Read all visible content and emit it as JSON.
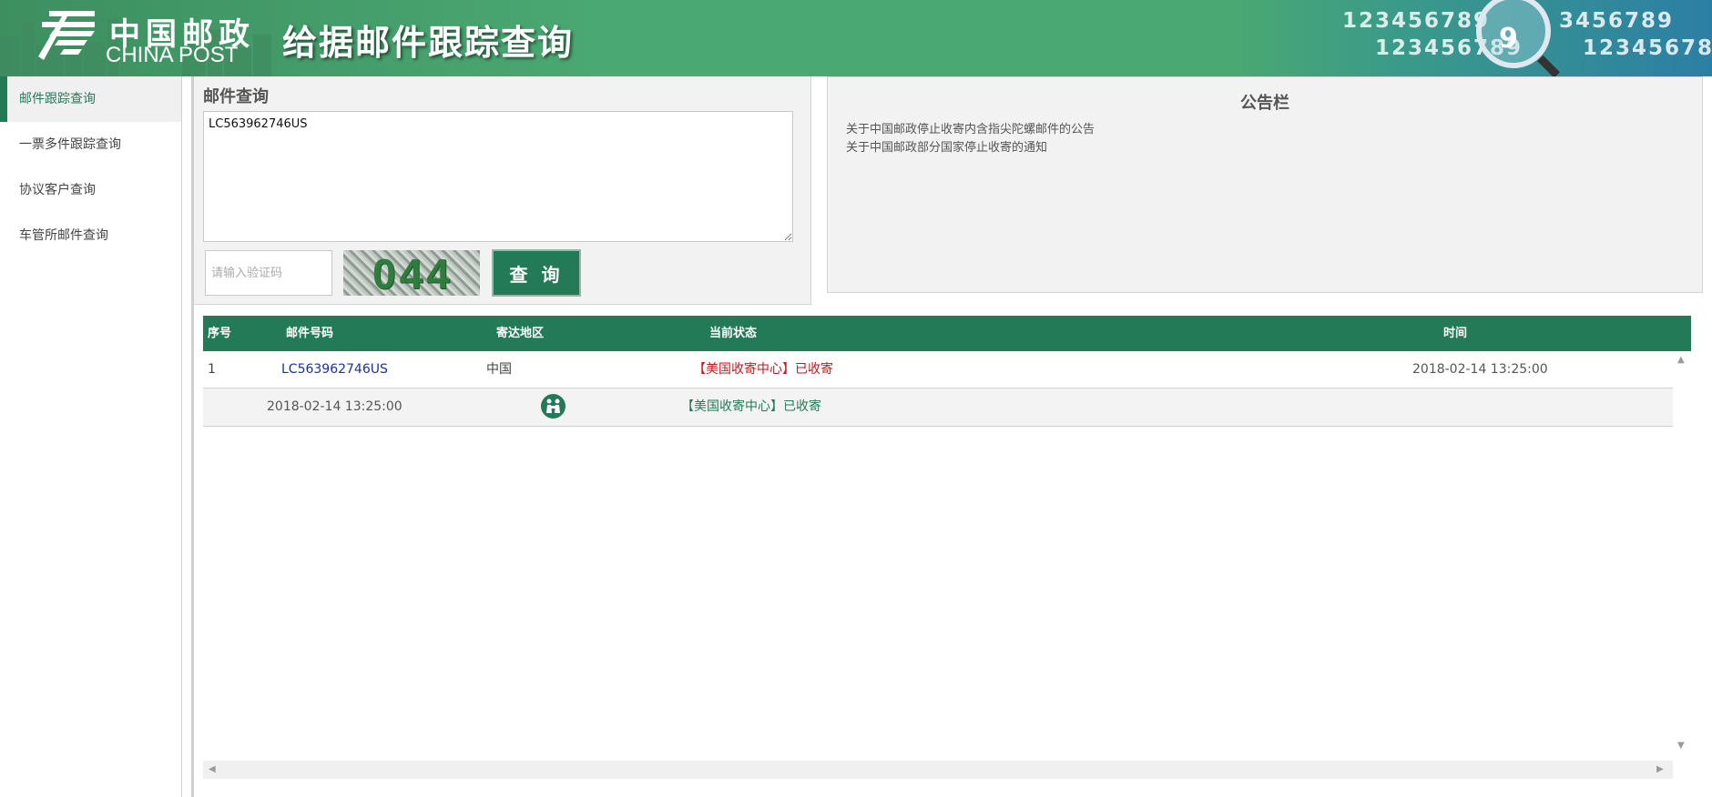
{
  "header": {
    "logo_cn": "中国邮政",
    "logo_en": "CHINA POST",
    "site_title": "给据邮件跟踪查询",
    "deco_numbers": [
      "123456789",
      "123456789",
      "3456789",
      "123456789"
    ]
  },
  "sidebar": {
    "items": [
      {
        "label": "邮件跟踪查询",
        "active": true
      },
      {
        "label": "一票多件跟踪查询",
        "active": false
      },
      {
        "label": "协议客户查询",
        "active": false
      },
      {
        "label": "车管所邮件查询",
        "active": false
      }
    ]
  },
  "query": {
    "title": "邮件查询",
    "tracking_value": "LC563962746US",
    "captcha_placeholder": "请输入验证码",
    "captcha_text": "044",
    "button_label": "查 询"
  },
  "notice": {
    "title": "公告栏",
    "items": [
      "关于中国邮政停止收寄内含指尖陀螺邮件的公告",
      "关于中国邮政部分国家停止收寄的通知"
    ]
  },
  "results": {
    "headers": [
      "序号",
      "邮件号码",
      "寄达地区",
      "当前状态",
      "时间"
    ],
    "rows": [
      {
        "index": "1",
        "tracking_no": "LC563962746US",
        "destination": "中国",
        "status": "【美国收寄中心】已收寄",
        "time": "2018-02-14 13:25:00"
      }
    ],
    "detail": {
      "time": "2018-02-14 13:25:00",
      "event": "【美国收寄中心】已收寄",
      "icon": "handover-icon"
    }
  },
  "colors": {
    "brand_green": "#237a57",
    "header_green": "#4aa872",
    "status_red": "#c8161d",
    "link_blue": "#1f2fa0"
  }
}
